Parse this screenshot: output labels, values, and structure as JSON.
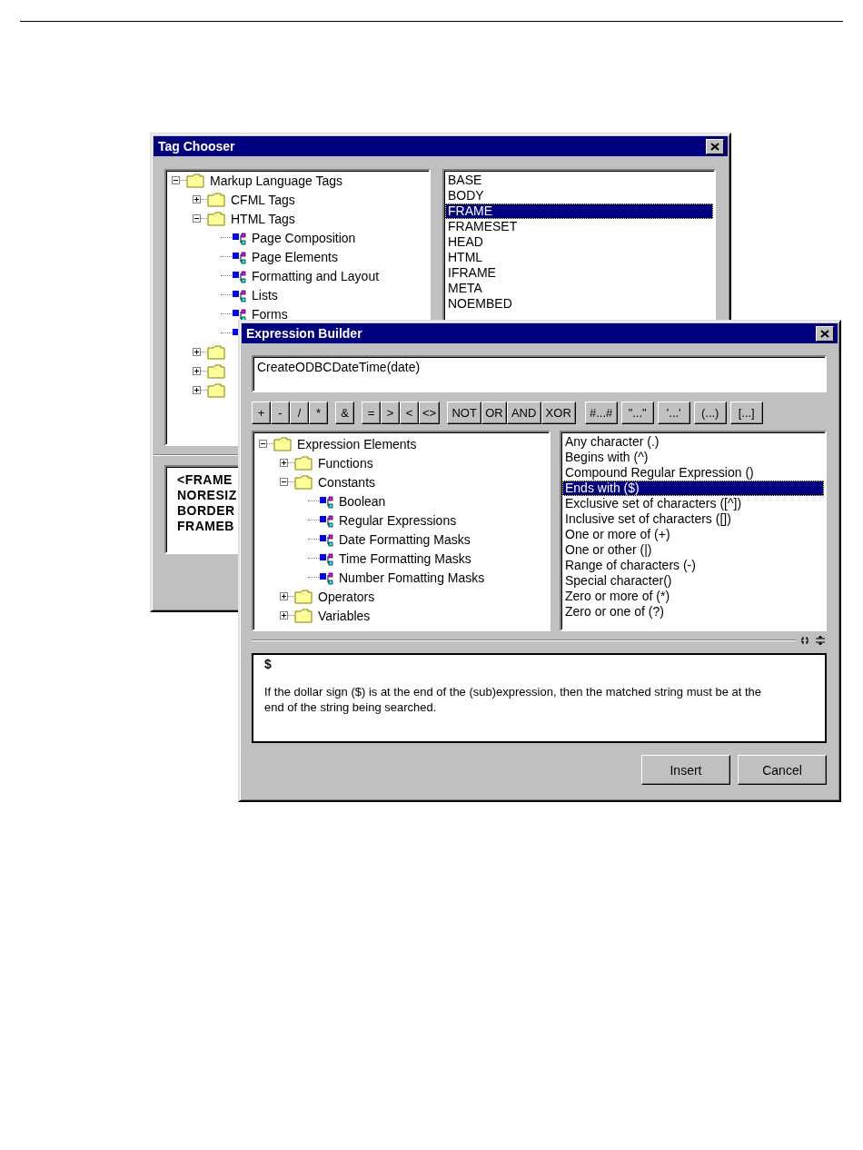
{
  "tag_chooser": {
    "title": "Tag Chooser",
    "tree": [
      {
        "label": "Markup Language Tags",
        "kind": "folder",
        "expanded": true,
        "children": [
          {
            "label": "CFML Tags",
            "kind": "folder",
            "expanded": false
          },
          {
            "label": "HTML Tags",
            "kind": "folder",
            "expanded": true,
            "children": [
              {
                "label": "Page Composition",
                "kind": "leaf"
              },
              {
                "label": "Page Elements",
                "kind": "leaf"
              },
              {
                "label": "Formatting and Layout",
                "kind": "leaf"
              },
              {
                "label": "Lists",
                "kind": "leaf"
              },
              {
                "label": "Forms",
                "kind": "leaf"
              },
              {
                "kind": "leaf"
              }
            ]
          },
          {
            "kind": "folder",
            "expanded": false
          },
          {
            "kind": "folder",
            "expanded": false
          },
          {
            "kind": "folder",
            "expanded": false
          }
        ]
      }
    ],
    "tags": [
      {
        "label": "BASE",
        "selected": false
      },
      {
        "label": "BODY",
        "selected": false
      },
      {
        "label": "FRAME",
        "selected": true
      },
      {
        "label": "FRAMESET",
        "selected": false
      },
      {
        "label": "HEAD",
        "selected": false
      },
      {
        "label": "HTML",
        "selected": false
      },
      {
        "label": "IFRAME",
        "selected": false
      },
      {
        "label": "META",
        "selected": false
      },
      {
        "label": "NOEMBED",
        "selected": false
      }
    ],
    "preview_lines": [
      "<FRAME",
      "NORESIZ",
      "BORDER",
      "FRAMEB"
    ]
  },
  "expression_builder": {
    "title": "Expression Builder",
    "expression": "CreateODBCDateTime(date)",
    "operator_groups": [
      [
        "+",
        "-",
        "/",
        "*"
      ],
      [
        "&"
      ],
      [
        "=",
        ">",
        "<",
        "<>"
      ],
      [
        "NOT",
        "OR",
        "AND",
        "XOR"
      ]
    ],
    "literal_buttons": [
      "#...#",
      "\"...\"",
      "'...'",
      "(...)",
      "[...]"
    ],
    "tree": [
      {
        "label": "Expression Elements",
        "kind": "folder",
        "expanded": true,
        "children": [
          {
            "label": "Functions",
            "kind": "folder",
            "expanded": false
          },
          {
            "label": "Constants",
            "kind": "folder",
            "expanded": true,
            "children": [
              {
                "label": "Boolean",
                "kind": "leaf"
              },
              {
                "label": "Regular Expressions",
                "kind": "leaf"
              },
              {
                "label": "Date Formatting Masks",
                "kind": "leaf"
              },
              {
                "label": "Time Formatting Masks",
                "kind": "leaf"
              },
              {
                "label": "Number Fomatting Masks",
                "kind": "leaf"
              }
            ]
          },
          {
            "label": "Operators",
            "kind": "folder",
            "expanded": false
          },
          {
            "label": "Variables",
            "kind": "folder",
            "expanded": false
          }
        ]
      }
    ],
    "items": [
      {
        "label": "Any character (.)",
        "selected": false
      },
      {
        "label": "Begins with (^)",
        "selected": false
      },
      {
        "label": "Compound Regular Expression ()",
        "selected": false
      },
      {
        "label": "Ends with ($)",
        "selected": true
      },
      {
        "label": "Exclusive set of characters ([^])",
        "selected": false
      },
      {
        "label": "Inclusive set of characters ([])",
        "selected": false
      },
      {
        "label": "One or more of (+)",
        "selected": false
      },
      {
        "label": "One or other (|)",
        "selected": false
      },
      {
        "label": "Range of characters (-)",
        "selected": false
      },
      {
        "label": "Special character()",
        "selected": false
      },
      {
        "label": "Zero or more of (*)",
        "selected": false
      },
      {
        "label": "Zero or one of (?)",
        "selected": false
      }
    ],
    "description_title": "$",
    "description": "If the dollar sign ($) is at the end of the (sub)expression, then the matched string must be at the end of the string being searched.",
    "buttons": [
      "Insert",
      "Cancel"
    ]
  }
}
